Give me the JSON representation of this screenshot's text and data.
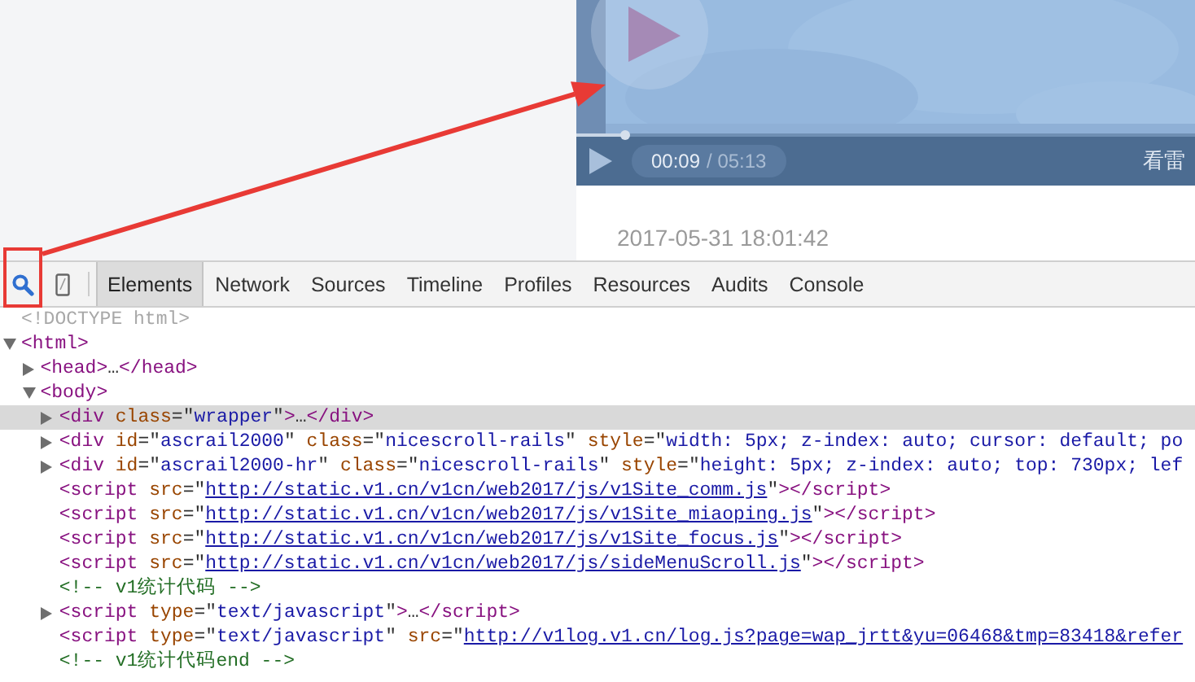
{
  "video": {
    "time_elapsed": "00:09",
    "time_total": "/ 05:13",
    "caption": "看雷",
    "level": 0.08
  },
  "post": {
    "date": "2017-05-31 18:01:42"
  },
  "devtools": {
    "tabs": [
      {
        "label": "Elements",
        "selected": true
      },
      {
        "label": "Network",
        "selected": false
      },
      {
        "label": "Sources",
        "selected": false
      },
      {
        "label": "Timeline",
        "selected": false
      },
      {
        "label": "Profiles",
        "selected": false
      },
      {
        "label": "Resources",
        "selected": false
      },
      {
        "label": "Audits",
        "selected": false
      },
      {
        "label": "Console",
        "selected": false
      }
    ],
    "tree": [
      {
        "selected": false,
        "tokens": [
          {
            "kind": "doctype",
            "t": "<!DOCTYPE html>"
          }
        ]
      },
      {
        "selected": false,
        "expanded": true,
        "tokens": [
          {
            "kind": "tag",
            "t": "<html>"
          }
        ],
        "children": [
          {
            "selected": false,
            "expanded": false,
            "tokens": [
              {
                "kind": "tag",
                "t": "<head>"
              },
              {
                "kind": "text",
                "t": "…"
              },
              {
                "kind": "tag",
                "t": "</head>"
              }
            ]
          },
          {
            "selected": false,
            "expanded": true,
            "tokens": [
              {
                "kind": "tag",
                "t": "<body>"
              }
            ],
            "children": [
              {
                "selected": true,
                "expanded": false,
                "tokens": [
                  {
                    "kind": "tag",
                    "t": "<div"
                  },
                  {
                    "kind": "attr",
                    "t": " class"
                  },
                  {
                    "kind": "punct",
                    "t": "=\""
                  },
                  {
                    "kind": "val",
                    "t": "wrapper"
                  },
                  {
                    "kind": "punct",
                    "t": "\""
                  },
                  {
                    "kind": "tag",
                    "t": ">"
                  },
                  {
                    "kind": "text",
                    "t": "…"
                  },
                  {
                    "kind": "tag",
                    "t": "</div>"
                  }
                ]
              },
              {
                "selected": false,
                "expanded": false,
                "tokens": [
                  {
                    "kind": "tag",
                    "t": "<div"
                  },
                  {
                    "kind": "attr",
                    "t": " id"
                  },
                  {
                    "kind": "punct",
                    "t": "=\""
                  },
                  {
                    "kind": "val",
                    "t": "ascrail2000"
                  },
                  {
                    "kind": "punct",
                    "t": "\""
                  },
                  {
                    "kind": "attr",
                    "t": " class"
                  },
                  {
                    "kind": "punct",
                    "t": "=\""
                  },
                  {
                    "kind": "val",
                    "t": "nicescroll-rails"
                  },
                  {
                    "kind": "punct",
                    "t": "\""
                  },
                  {
                    "kind": "attr",
                    "t": " style"
                  },
                  {
                    "kind": "punct",
                    "t": "=\""
                  },
                  {
                    "kind": "val",
                    "t": "width: 5px; z-index: auto; cursor: default; po"
                  }
                ]
              },
              {
                "selected": false,
                "expanded": false,
                "tokens": [
                  {
                    "kind": "tag",
                    "t": "<div"
                  },
                  {
                    "kind": "attr",
                    "t": " id"
                  },
                  {
                    "kind": "punct",
                    "t": "=\""
                  },
                  {
                    "kind": "val",
                    "t": "ascrail2000-hr"
                  },
                  {
                    "kind": "punct",
                    "t": "\""
                  },
                  {
                    "kind": "attr",
                    "t": " class"
                  },
                  {
                    "kind": "punct",
                    "t": "=\""
                  },
                  {
                    "kind": "val",
                    "t": "nicescroll-rails"
                  },
                  {
                    "kind": "punct",
                    "t": "\""
                  },
                  {
                    "kind": "attr",
                    "t": " style"
                  },
                  {
                    "kind": "punct",
                    "t": "=\""
                  },
                  {
                    "kind": "val",
                    "t": "height: 5px; z-index: auto; top: 730px; lef"
                  }
                ]
              },
              {
                "selected": false,
                "tokens": [
                  {
                    "kind": "tag",
                    "t": "<script"
                  },
                  {
                    "kind": "attr",
                    "t": " src"
                  },
                  {
                    "kind": "punct",
                    "t": "=\""
                  },
                  {
                    "kind": "link",
                    "t": "http://static.v1.cn/v1cn/web2017/js/v1Site_comm.js"
                  },
                  {
                    "kind": "punct",
                    "t": "\""
                  },
                  {
                    "kind": "tag",
                    "t": "></script>"
                  }
                ]
              },
              {
                "selected": false,
                "tokens": [
                  {
                    "kind": "tag",
                    "t": "<script"
                  },
                  {
                    "kind": "attr",
                    "t": " src"
                  },
                  {
                    "kind": "punct",
                    "t": "=\""
                  },
                  {
                    "kind": "link",
                    "t": "http://static.v1.cn/v1cn/web2017/js/v1Site_miaoping.js"
                  },
                  {
                    "kind": "punct",
                    "t": "\""
                  },
                  {
                    "kind": "tag",
                    "t": "></script>"
                  }
                ]
              },
              {
                "selected": false,
                "tokens": [
                  {
                    "kind": "tag",
                    "t": "<script"
                  },
                  {
                    "kind": "attr",
                    "t": " src"
                  },
                  {
                    "kind": "punct",
                    "t": "=\""
                  },
                  {
                    "kind": "link",
                    "t": "http://static.v1.cn/v1cn/web2017/js/v1Site_focus.js"
                  },
                  {
                    "kind": "punct",
                    "t": "\""
                  },
                  {
                    "kind": "tag",
                    "t": "></script>"
                  }
                ]
              },
              {
                "selected": false,
                "tokens": [
                  {
                    "kind": "tag",
                    "t": "<script"
                  },
                  {
                    "kind": "attr",
                    "t": " src"
                  },
                  {
                    "kind": "punct",
                    "t": "=\""
                  },
                  {
                    "kind": "link",
                    "t": "http://static.v1.cn/v1cn/web2017/js/sideMenuScroll.js"
                  },
                  {
                    "kind": "punct",
                    "t": "\""
                  },
                  {
                    "kind": "tag",
                    "t": "></script>"
                  }
                ]
              },
              {
                "selected": false,
                "tokens": [
                  {
                    "kind": "comment",
                    "t": "<!-- v1统计代码 -->"
                  }
                ]
              },
              {
                "selected": false,
                "expanded": false,
                "tokens": [
                  {
                    "kind": "tag",
                    "t": "<script"
                  },
                  {
                    "kind": "attr",
                    "t": " type"
                  },
                  {
                    "kind": "punct",
                    "t": "=\""
                  },
                  {
                    "kind": "val",
                    "t": "text/javascript"
                  },
                  {
                    "kind": "punct",
                    "t": "\""
                  },
                  {
                    "kind": "tag",
                    "t": ">"
                  },
                  {
                    "kind": "text",
                    "t": "…"
                  },
                  {
                    "kind": "tag",
                    "t": "</script>"
                  }
                ]
              },
              {
                "selected": false,
                "tokens": [
                  {
                    "kind": "tag",
                    "t": "<script"
                  },
                  {
                    "kind": "attr",
                    "t": " type"
                  },
                  {
                    "kind": "punct",
                    "t": "=\""
                  },
                  {
                    "kind": "val",
                    "t": "text/javascript"
                  },
                  {
                    "kind": "punct",
                    "t": "\""
                  },
                  {
                    "kind": "attr",
                    "t": " src"
                  },
                  {
                    "kind": "punct",
                    "t": "=\""
                  },
                  {
                    "kind": "link",
                    "t": "http://v1log.v1.cn/log.js?page=wap_jrtt&yu=06468&tmp=83418&refer"
                  }
                ]
              },
              {
                "selected": false,
                "tokens": [
                  {
                    "kind": "comment",
                    "t": "<!-- v1统计代码end -->"
                  }
                ]
              }
            ]
          }
        ]
      }
    ]
  }
}
